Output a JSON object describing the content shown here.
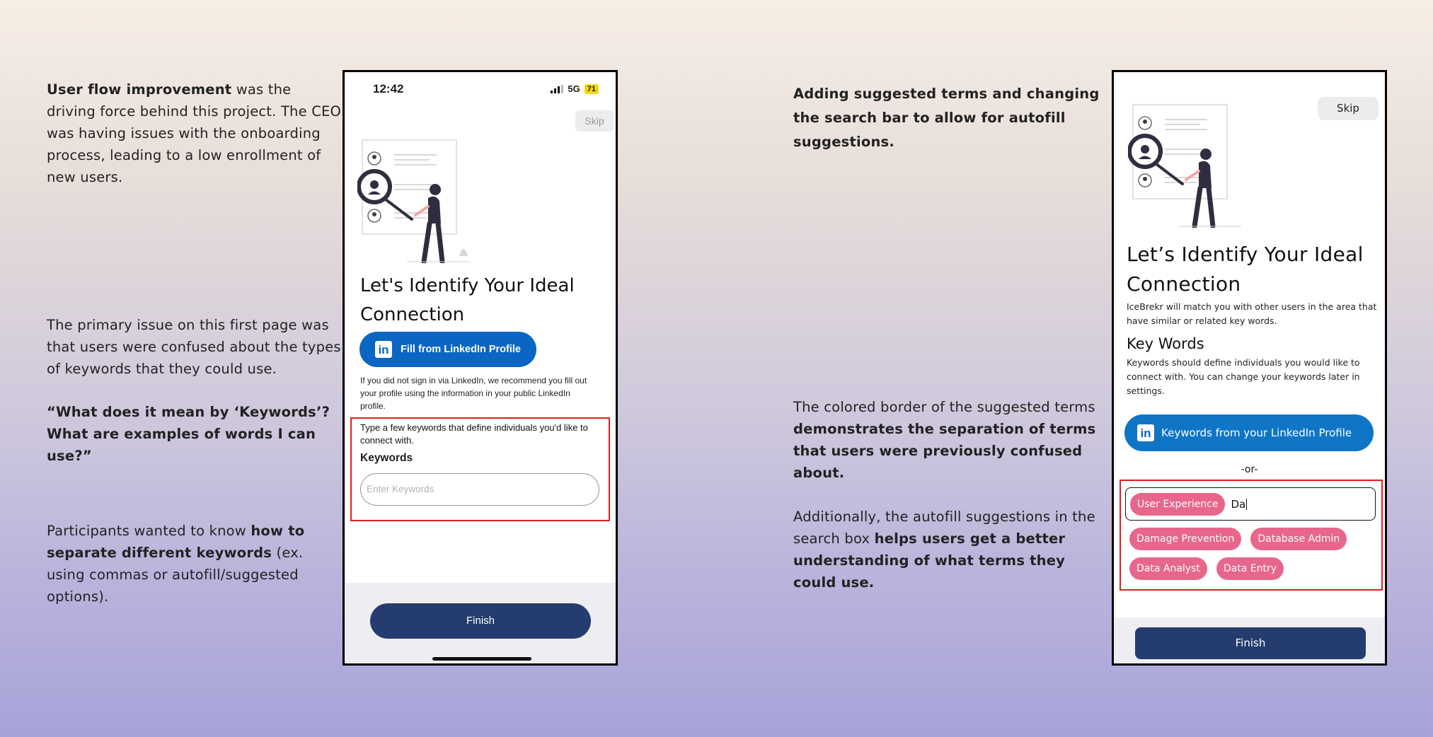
{
  "left_notes": {
    "n1_bold": "User flow improvement",
    "n1_rest": " was the driving force behind this project. The CEO was having issues with the onboarding process, leading to a low enrollment of new users.",
    "n2": "The primary issue on this first page was that users were confused about the types of keywords that they could use.",
    "n3_quote": "“What does it mean by ‘Keywords’? What are examples of words I can use?”",
    "n4_start": "Participants wanted to know ",
    "n4_bold": "how to separate different keywords",
    "n4_end": " (ex. using commas or autofill/suggested options)."
  },
  "right_notes": {
    "r1": "Adding suggested terms and changing the search bar to allow for autofill suggestions.",
    "r2_start": "The colored border of the suggested terms ",
    "r2_bold": "demonstrates the separation of terms that users were previously confused about.",
    "r3_start": "Additionally, the autofill suggestions in the search box ",
    "r3_bold": "helps users get a better understanding of what terms they could use."
  },
  "phone1": {
    "time": "12:42",
    "network": "5G",
    "battery": "71",
    "skip": "Skip",
    "title": "Let's Identify Your Ideal Connection",
    "linkedin_button": "Fill from LinkedIn Profile",
    "linkedin_icon": "in",
    "linkedin_desc": "If you did not sign in via LinkedIn, we recommend you fill out your profile using the information in your public LinkedIn profile.",
    "keywords_desc": "Type a few keywords that define individuals you'd like to connect with.",
    "keywords_label": "Keywords",
    "keywords_placeholder": "Enter Keywords",
    "finish": "Finish"
  },
  "phone2": {
    "skip": "Skip",
    "title": "Let’s Identify Your Ideal Connection",
    "subtitle": "IceBrekr will match you with other users in the area that have similar or related key words.",
    "keywords_heading": "Key Words",
    "keywords_desc": "Keywords should define individuals you would like to connect with. You can change your keywords later in settings.",
    "linkedin_button": "Keywords from your LinkedIn Profile",
    "linkedin_icon": "in",
    "or_text": "-or-",
    "selected_chip": "User Experience",
    "typed_text": "Da",
    "suggestions": [
      "Damage Prevention",
      "Database Admin",
      "Data Analyst",
      "Data Entry"
    ],
    "finish": "Finish"
  },
  "colors": {
    "linkedin_blue": "#0a66c2",
    "finish_navy": "#243d6e",
    "chip_pink": "#e8668b",
    "highlight_red": "#e11d1d"
  }
}
